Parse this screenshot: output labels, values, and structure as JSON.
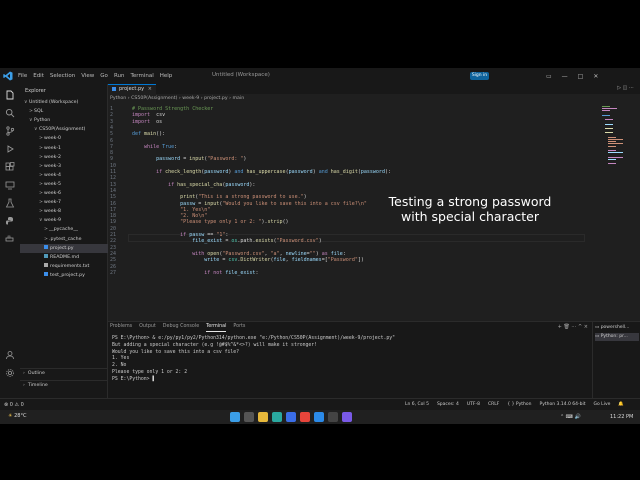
{
  "titlebar": {
    "menus": [
      "File",
      "Edit",
      "Selection",
      "View",
      "Go",
      "Run",
      "Terminal",
      "Help"
    ],
    "title": "Untitled (Workspace)",
    "signin": "Sign in"
  },
  "sidebar": {
    "header": "Explorer",
    "items": [
      {
        "label": "Untitled (Workspace)",
        "indent": 0,
        "chev": "∨"
      },
      {
        "label": "SQL",
        "indent": 1,
        "chev": ">"
      },
      {
        "label": "Python",
        "indent": 1,
        "chev": "∨"
      },
      {
        "label": "CS50P(Assignment)",
        "indent": 2,
        "chev": "∨"
      },
      {
        "label": "week-0",
        "indent": 3,
        "chev": ">"
      },
      {
        "label": "week-1",
        "indent": 3,
        "chev": ">"
      },
      {
        "label": "week-2",
        "indent": 3,
        "chev": ">"
      },
      {
        "label": "week-3",
        "indent": 3,
        "chev": ">"
      },
      {
        "label": "week-4",
        "indent": 3,
        "chev": ">"
      },
      {
        "label": "week-5",
        "indent": 3,
        "chev": ">"
      },
      {
        "label": "week-6",
        "indent": 3,
        "chev": ">"
      },
      {
        "label": "week-7",
        "indent": 3,
        "chev": ">"
      },
      {
        "label": "week-8",
        "indent": 3,
        "chev": ">"
      },
      {
        "label": "week-9",
        "indent": 3,
        "chev": "∨"
      },
      {
        "label": "__pycache__",
        "indent": 4,
        "chev": ">"
      },
      {
        "label": ".pytest_cache",
        "indent": 4,
        "chev": ">"
      },
      {
        "label": "project.py",
        "indent": 4,
        "chev": "",
        "icon": "#3b8eea",
        "selected": true
      },
      {
        "label": "README.md",
        "indent": 4,
        "chev": "",
        "icon": "#519aba"
      },
      {
        "label": "requirements.txt",
        "indent": 4,
        "chev": "",
        "icon": "#aaaaaa"
      },
      {
        "label": "test_project.py",
        "indent": 4,
        "chev": "",
        "icon": "#3b8eea"
      }
    ],
    "outline": "Outline",
    "timeline": "Timeline"
  },
  "editor": {
    "tab": "project.py",
    "breadcrumb": "Python › CS50P(Assignment) › week-9 › project.py › main",
    "line_numbers": [
      "1",
      "2",
      "3",
      "4",
      "5",
      "6",
      "7",
      "8",
      "9",
      "10",
      "11",
      "12",
      "13",
      "14",
      "15",
      "16",
      "17",
      "18",
      "19",
      "20",
      "21",
      "22",
      "23",
      "24",
      "25",
      "26",
      "27",
      "28",
      "29",
      "30",
      "31"
    ],
    "lines": [
      [
        [
          "cm",
          "# Password Strength Checker"
        ]
      ],
      [
        [
          "kc",
          "import"
        ],
        [
          "",
          "  csv"
        ]
      ],
      [
        [
          "kc",
          "import"
        ],
        [
          "",
          "  os"
        ]
      ],
      [],
      [
        [
          "kw",
          "def "
        ],
        [
          "fn",
          "main"
        ],
        [
          "",
          "():"
        ]
      ],
      [],
      [
        [
          "",
          "    "
        ],
        [
          "kc",
          "while "
        ],
        [
          "kw",
          "True"
        ],
        [
          "",
          ":"
        ]
      ],
      [],
      [
        [
          "",
          "        "
        ],
        [
          "va",
          "password"
        ],
        [
          "",
          " = "
        ],
        [
          "fn",
          "input"
        ],
        [
          "",
          "("
        ],
        [
          "st",
          "\"Password: \""
        ],
        [
          "",
          ")"
        ]
      ],
      [],
      [
        [
          "",
          "        "
        ],
        [
          "kc",
          "if "
        ],
        [
          "fn",
          "check_length"
        ],
        [
          "",
          "("
        ],
        [
          "va",
          "password"
        ],
        [
          "",
          ") "
        ],
        [
          "kw",
          "and "
        ],
        [
          "fn",
          "has_uppercase"
        ],
        [
          "",
          "("
        ],
        [
          "va",
          "password"
        ],
        [
          "",
          ") "
        ],
        [
          "kw",
          "and "
        ],
        [
          "fn",
          "has_digit"
        ],
        [
          "",
          "("
        ],
        [
          "va",
          "password"
        ],
        [
          "",
          "):"
        ]
      ],
      [],
      [
        [
          "",
          "            "
        ],
        [
          "kc",
          "if "
        ],
        [
          "fn",
          "has_special_cha"
        ],
        [
          "",
          "("
        ],
        [
          "va",
          "password"
        ],
        [
          "",
          "):"
        ]
      ],
      [],
      [
        [
          "",
          "                "
        ],
        [
          "fn",
          "print"
        ],
        [
          "",
          "("
        ],
        [
          "st",
          "\"This is a strong password to use.\""
        ],
        [
          "",
          ")"
        ]
      ],
      [
        [
          "",
          "                "
        ],
        [
          "va",
          "passw"
        ],
        [
          "",
          " = "
        ],
        [
          "fn",
          "input"
        ],
        [
          "",
          "("
        ],
        [
          "st",
          "\"Would you like to save this into a csv file?\\n\""
        ]
      ],
      [
        [
          "",
          "                "
        ],
        [
          "st",
          "\"1. Yes\\n\""
        ]
      ],
      [
        [
          "",
          "                "
        ],
        [
          "st",
          "\"2. No\\n\""
        ]
      ],
      [
        [
          "",
          "                "
        ],
        [
          "st",
          "\"Please type only 1 or 2: \""
        ],
        [
          "",
          ")."
        ],
        [
          "fn",
          "strip"
        ],
        [
          "",
          "()"
        ]
      ],
      [],
      [
        [
          "",
          "                "
        ],
        [
          "kc",
          "if "
        ],
        [
          "va",
          "passw"
        ],
        [
          "",
          " == "
        ],
        [
          "st",
          "\"1\""
        ],
        [
          "",
          ":"
        ]
      ],
      [
        [
          "",
          "                    "
        ],
        [
          "va",
          "file_exist"
        ],
        [
          "",
          " = "
        ],
        [
          "cl",
          "os"
        ],
        [
          "",
          ".path."
        ],
        [
          "fn",
          "exists"
        ],
        [
          "",
          "("
        ],
        [
          "st",
          "\"Password.csv\""
        ],
        [
          "",
          ")"
        ]
      ],
      [],
      [
        [
          "",
          "                    "
        ],
        [
          "kc",
          "with "
        ],
        [
          "fn",
          "open"
        ],
        [
          "",
          "("
        ],
        [
          "st",
          "\"Password.csv\""
        ],
        [
          "",
          ", "
        ],
        [
          "st",
          "\"a\""
        ],
        [
          "",
          ", "
        ],
        [
          "va",
          "newline"
        ],
        [
          "",
          "="
        ],
        [
          "st",
          "\"\""
        ],
        [
          "",
          ") "
        ],
        [
          "kc",
          "as "
        ],
        [
          "va",
          "file"
        ],
        [
          "",
          ":"
        ]
      ],
      [
        [
          "",
          "                        "
        ],
        [
          "va",
          "write"
        ],
        [
          "",
          " = "
        ],
        [
          "cl",
          "csv"
        ],
        [
          "",
          "."
        ],
        [
          "fn",
          "DictWriter"
        ],
        [
          "",
          "("
        ],
        [
          "va",
          "file"
        ],
        [
          "",
          ", "
        ],
        [
          "va",
          "fieldnames"
        ],
        [
          "",
          "=["
        ],
        [
          "st",
          "\"Password\""
        ],
        [
          "",
          "])"
        ]
      ],
      [],
      [
        [
          "",
          "                        "
        ],
        [
          "kc",
          "if not "
        ],
        [
          "va",
          "file_exist"
        ],
        [
          "",
          ":"
        ]
      ]
    ]
  },
  "overlay": {
    "line1": "Testing a strong password",
    "line2": "with special character"
  },
  "panel": {
    "tabs": [
      "Problems",
      "Output",
      "Debug Console",
      "Terminal",
      "Ports"
    ],
    "active_tab": "Terminal",
    "terminal": [
      "PS E:\\Python> & e:/py/py1/py2/Python314/python.exe \"e:/Python/CS50P(Assignment)/week-9/project.py\"",
      "But adding a special character (e.g !@#$%^&*<>?) will make it stronger!",
      "Would you like to save this into a csv file?",
      "1. Yes",
      "2. No",
      "Please type only 1 or 2: 2",
      "PS E:\\Python> "
    ],
    "terminals": [
      "powershell...",
      "Python: pr..."
    ]
  },
  "statusbar": {
    "left": "⊗ 0 ⚠ 0",
    "right": [
      "Ln 6, Col 5",
      "Spaces: 4",
      "UTF-8",
      "CRLF",
      "{ } Python",
      "Python 3.14.0 64-bit",
      "Go Live"
    ]
  },
  "taskbar": {
    "weather": "28°C",
    "clock": "11:22 PM"
  }
}
